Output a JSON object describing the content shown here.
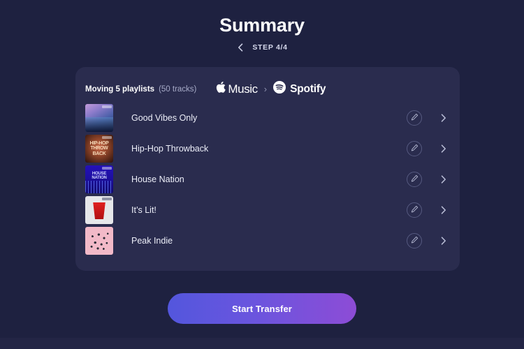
{
  "header": {
    "title": "Summary",
    "back_icon": "chevron-left-icon",
    "step_label": "STEP 4/4"
  },
  "card": {
    "moving_text": "Moving 5 playlists",
    "tracks_text": "(50 tracks)",
    "source": {
      "name": "Music",
      "icon": "apple-logo-icon"
    },
    "separator": "›",
    "destination": {
      "name": "Spotify",
      "icon": "spotify-logo-icon"
    },
    "rows": [
      {
        "title": "Good Vibes Only",
        "art": "art-goodvibes",
        "edit_icon": "pencil-icon",
        "chevron_icon": "chevron-right-icon"
      },
      {
        "title": "Hip-Hop Throwback",
        "art": "art-hiphop",
        "art_text_1": "HIP-HOP",
        "art_text_2": "THROW",
        "art_text_3": "BACK",
        "edit_icon": "pencil-icon",
        "chevron_icon": "chevron-right-icon"
      },
      {
        "title": "House Nation",
        "art": "art-house",
        "art_text_1": "HOUSE NATION",
        "edit_icon": "pencil-icon",
        "chevron_icon": "chevron-right-icon"
      },
      {
        "title": "It’s Lit!",
        "art": "art-lit",
        "edit_icon": "pencil-icon",
        "chevron_icon": "chevron-right-icon"
      },
      {
        "title": "Peak Indie",
        "art": "art-peak",
        "edit_icon": "pencil-icon",
        "chevron_icon": "chevron-right-icon"
      }
    ]
  },
  "cta": {
    "label": "Start Transfer"
  },
  "colors": {
    "page_bg": "#1e2140",
    "card_bg": "#2a2c4e",
    "accent_start": "#5356dd",
    "accent_end": "#8d4cd6",
    "muted_text": "#a7abc8"
  }
}
